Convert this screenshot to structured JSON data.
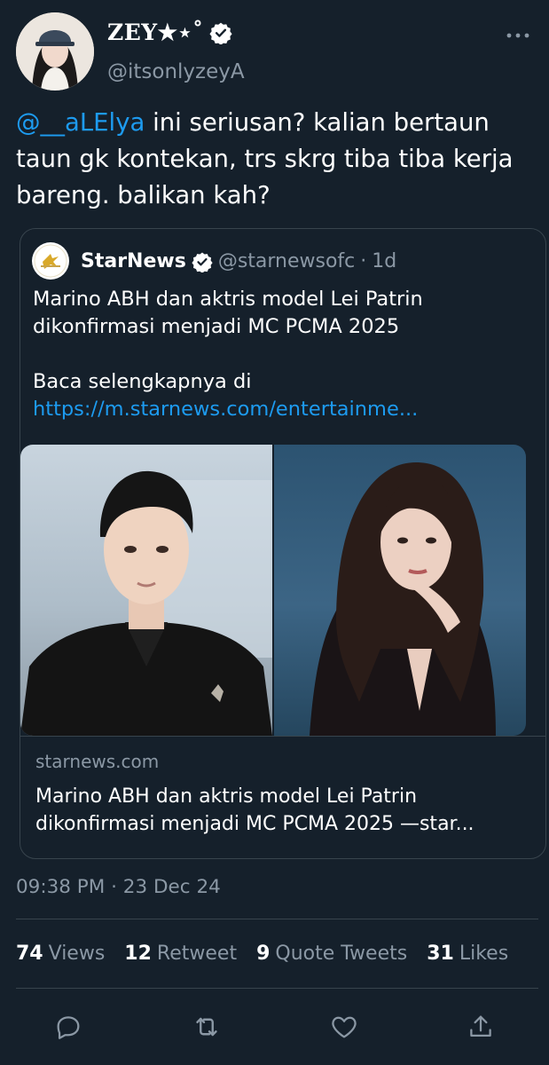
{
  "author": {
    "display_name": "ZEY★⋆˚",
    "handle": "@itsonlyzeyA",
    "verified": true
  },
  "tweet": {
    "mention": "@__aLElya",
    "text": " ini seriusan? kalian bertaun taun gk kontekan, trs skrg tiba tiba kerja bareng. balikan kah?"
  },
  "quote": {
    "name": "StarNews",
    "handle": "@starnewsofc",
    "separator": "·",
    "time": "1d",
    "body_line": "Marino ABH dan aktris model Lei Patrin dikonfirmasi menjadi MC PCMA 2025",
    "read_more": "Baca selengkapnya di",
    "link": "https://m.starnews.com/entertainme...",
    "card_domain": "starnews.com",
    "card_title": "Marino ABH dan aktris model Lei Patrin dikonfirmasi menjadi MC PCMA 2025 —star..."
  },
  "timestamp": "09:38 PM · 23 Dec 24",
  "stats": {
    "views_count": "74",
    "views_label": "Views",
    "retweets_count": "12",
    "retweets_label": "Retweet",
    "quotes_count": "9",
    "quotes_label": "Quote Tweets",
    "likes_count": "31",
    "likes_label": "Likes"
  },
  "actions": [
    "reply-icon",
    "retweet-icon",
    "like-icon",
    "share-icon"
  ],
  "colors": {
    "background": "#15202b",
    "accent": "#1d9bf0",
    "muted": "#8b98a5",
    "border": "#38444d"
  }
}
